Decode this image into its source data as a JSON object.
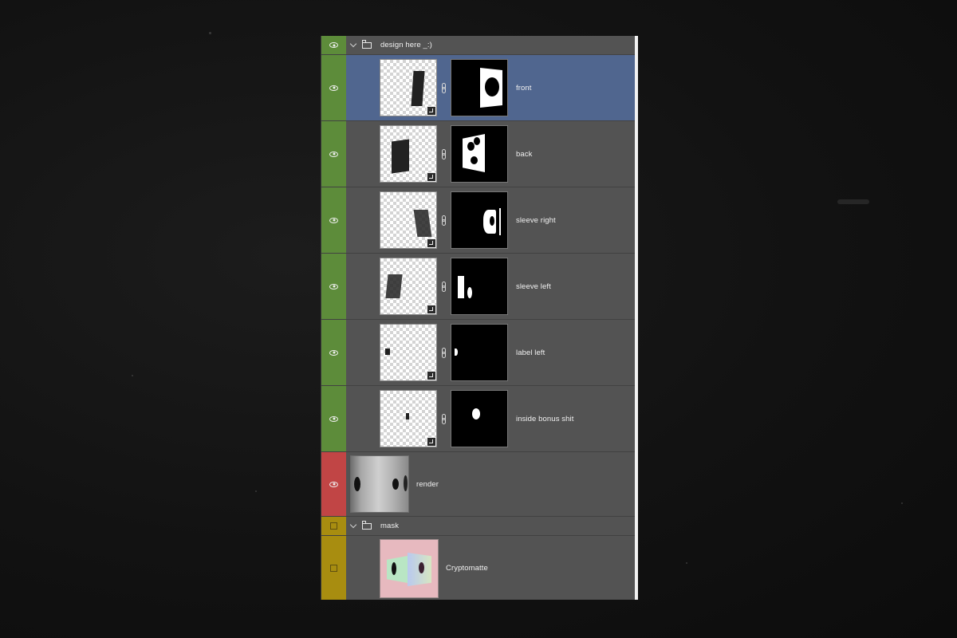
{
  "layers_panel": {
    "groups": [
      {
        "name": "design here _:)",
        "visibility_color": "#5d8c3a",
        "visible": true,
        "layers": [
          {
            "name": "front",
            "selected": true,
            "visible": true,
            "type": "smart-object-with-mask"
          },
          {
            "name": "back",
            "selected": false,
            "visible": true,
            "type": "smart-object-with-mask"
          },
          {
            "name": "sleeve right",
            "selected": false,
            "visible": true,
            "type": "smart-object-with-mask"
          },
          {
            "name": "sleeve left",
            "selected": false,
            "visible": true,
            "type": "smart-object-with-mask"
          },
          {
            "name": "label left",
            "selected": false,
            "visible": true,
            "type": "smart-object-with-mask"
          },
          {
            "name": "inside bonus shit",
            "selected": false,
            "visible": true,
            "type": "smart-object-with-mask"
          }
        ]
      }
    ],
    "standalone_layer": {
      "name": "render",
      "visibility_color": "#c14545",
      "visible": true
    },
    "mask_group": {
      "name": "mask",
      "visibility_color": "#a88d10",
      "visible": false,
      "layers": [
        {
          "name": "Cryptomatte",
          "visible": false
        }
      ]
    },
    "colors": {
      "panel_bg": "#535353",
      "selected_row": "#50668f",
      "separator": "#414141"
    }
  }
}
